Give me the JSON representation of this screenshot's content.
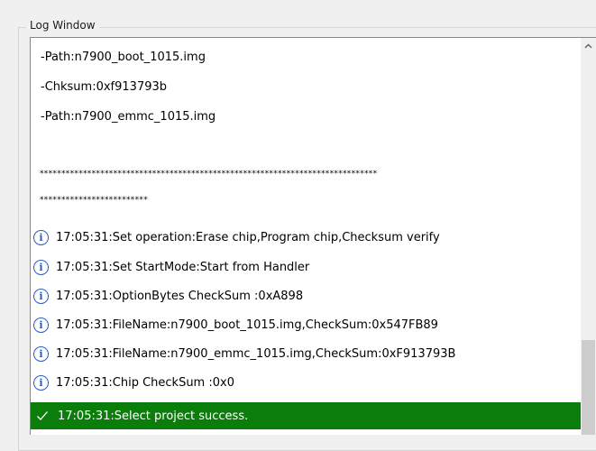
{
  "groupbox": {
    "title": "Log Window"
  },
  "log": {
    "entries": [
      {
        "type": "plain",
        "text": "-Path:n7900_boot_1015.img"
      },
      {
        "type": "plain",
        "text": "-Chksum:0xf913793b"
      },
      {
        "type": "plain",
        "text": "-Path:n7900_emmc_1015.img"
      },
      {
        "type": "blank",
        "text": ""
      },
      {
        "type": "star",
        "text": "******************************************************************************"
      },
      {
        "type": "star",
        "text": "*************************"
      },
      {
        "type": "info",
        "icon": "info-icon",
        "text": "17:05:31:Set operation:Erase chip,Program chip,Checksum verify"
      },
      {
        "type": "info",
        "icon": "info-icon",
        "text": "17:05:31:Set StartMode:Start from Handler"
      },
      {
        "type": "info",
        "icon": "info-icon",
        "text": "17:05:31:OptionBytes CheckSum :0xA898"
      },
      {
        "type": "info",
        "icon": "info-icon",
        "text": "17:05:31:FileName:n7900_boot_1015.img,CheckSum:0x547FB89"
      },
      {
        "type": "info",
        "icon": "info-icon",
        "text": "17:05:31:FileName:n7900_emmc_1015.img,CheckSum:0xF913793B"
      },
      {
        "type": "info",
        "icon": "info-icon",
        "text": "17:05:31:Chip CheckSum :0x0"
      },
      {
        "type": "success",
        "icon": "check-icon",
        "text": "17:05:31:Select project success."
      }
    ]
  },
  "colors": {
    "success_bg": "#0a7d0a",
    "info_icon": "#2b59c3",
    "scroll_thumb": "#cdcdcd"
  }
}
